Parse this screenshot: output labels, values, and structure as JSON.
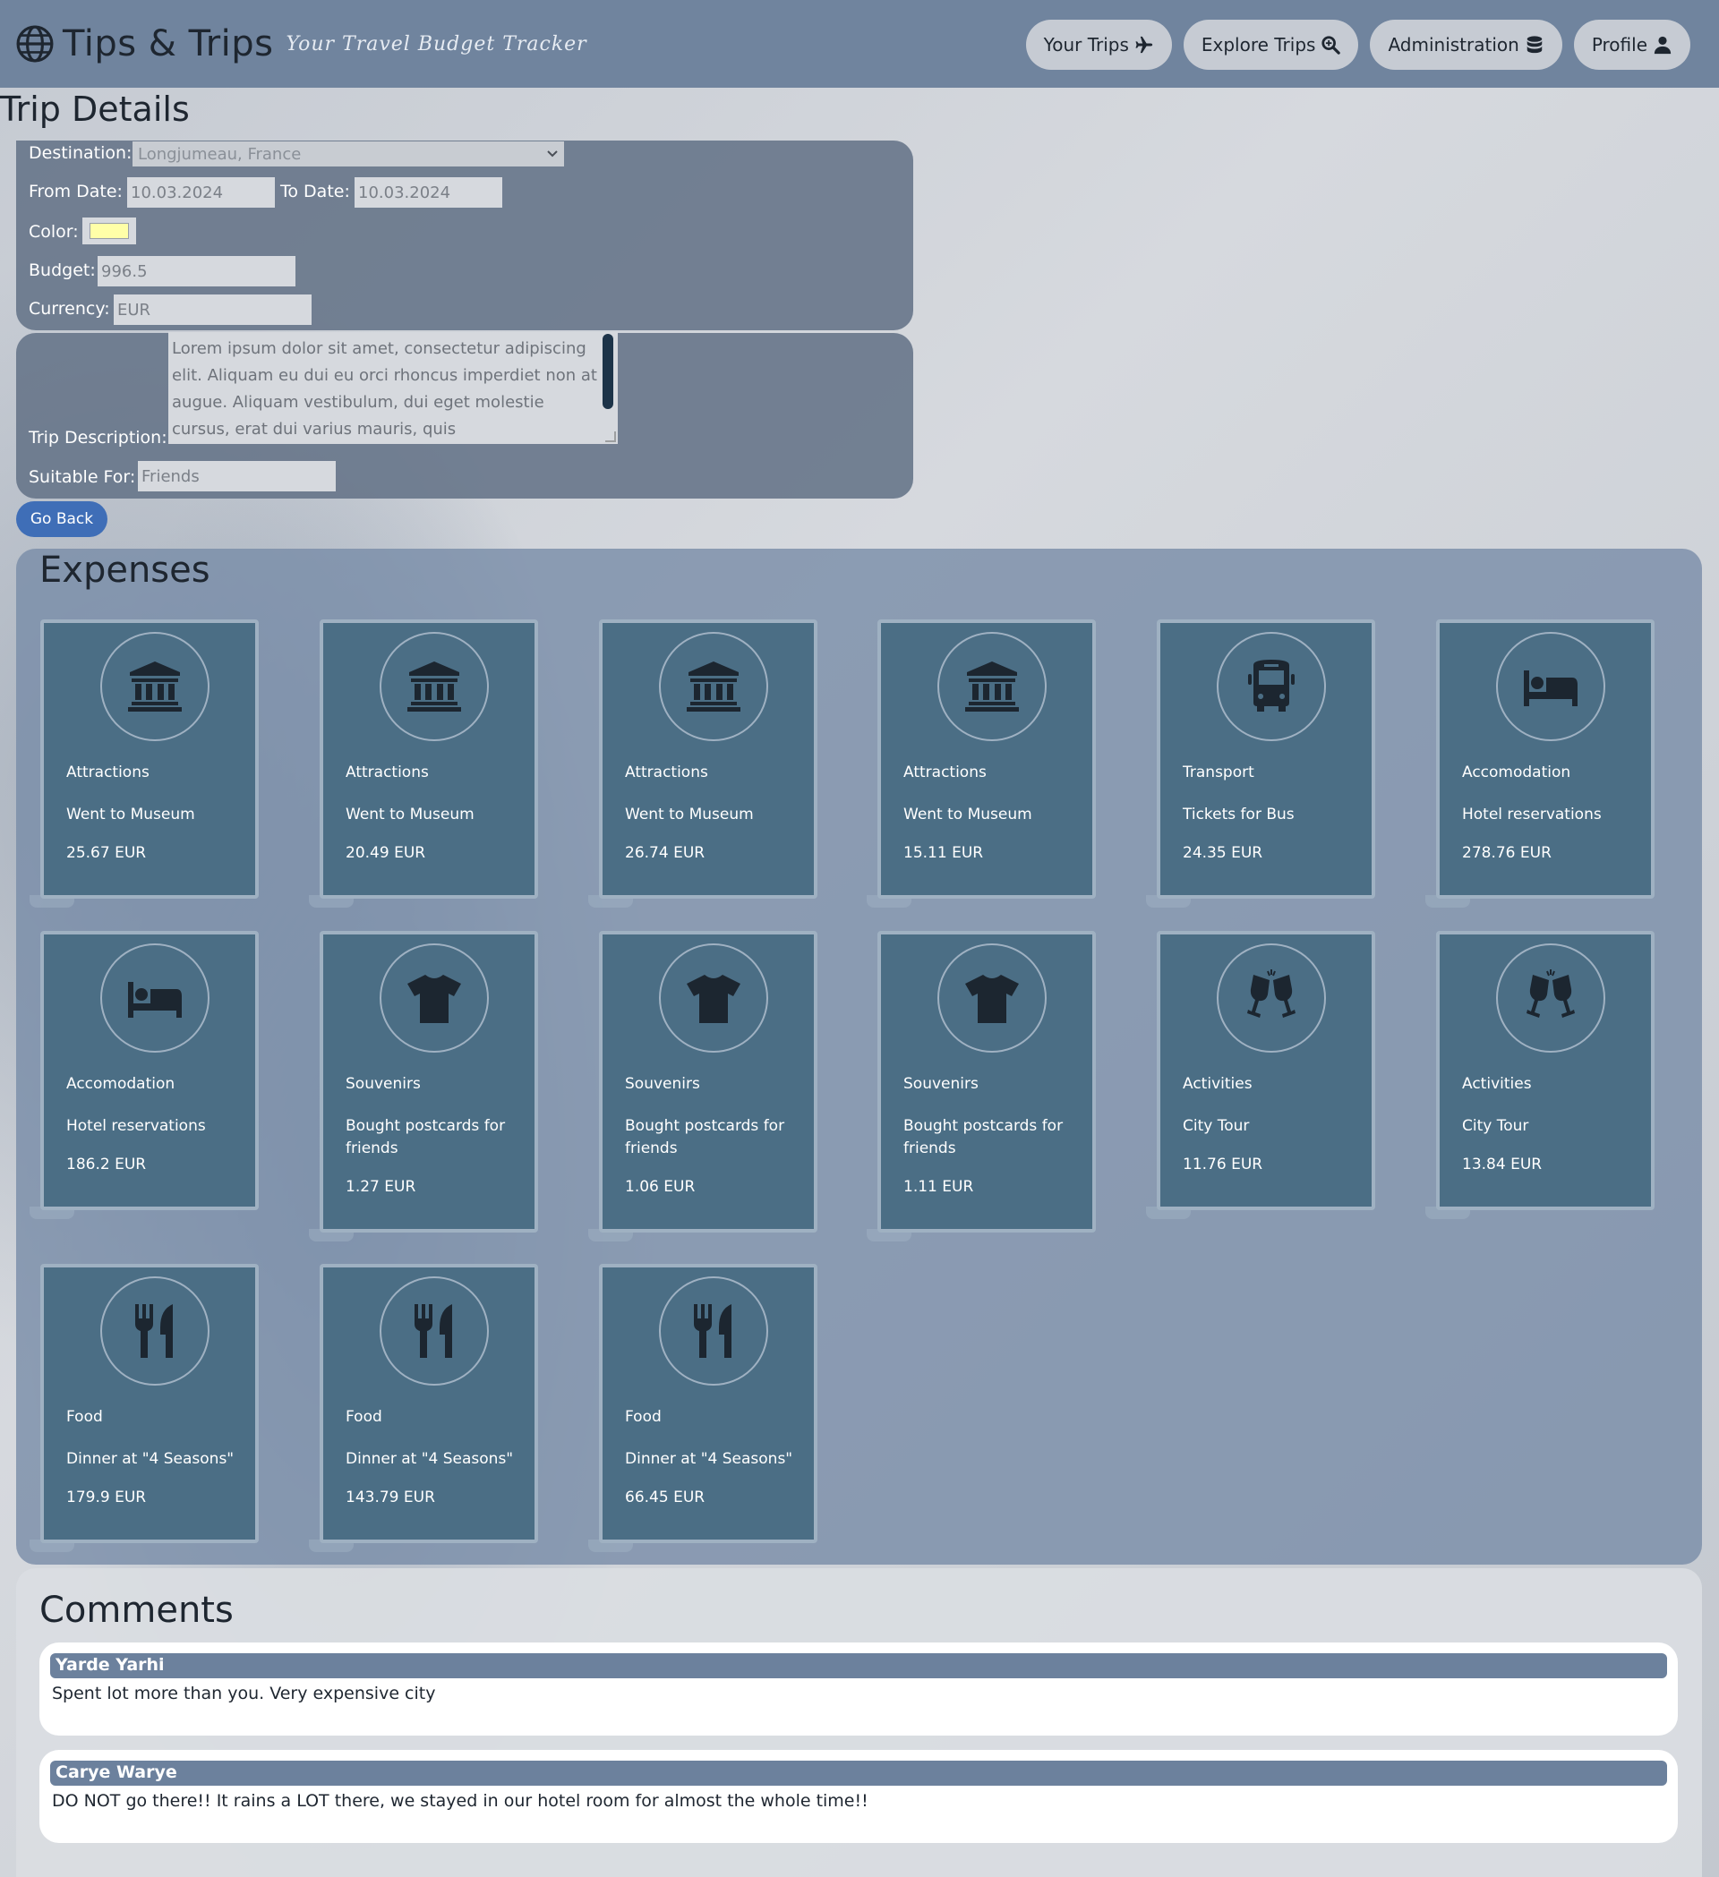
{
  "header": {
    "title": "Tips & Trips",
    "tagline": "Your Travel Budget Tracker",
    "nav": [
      {
        "label": "Your Trips",
        "icon": "plane-icon"
      },
      {
        "label": "Explore Trips",
        "icon": "search-icon"
      },
      {
        "label": "Administration",
        "icon": "database-icon"
      },
      {
        "label": "Profile",
        "icon": "user-icon"
      }
    ]
  },
  "trip": {
    "page_title": "Trip Details",
    "destination_label": "Destination:",
    "destination_value": "Longjumeau, France",
    "from_label": "From Date:",
    "from_value": "10.03.2024",
    "to_label": "To Date:",
    "to_value": "10.03.2024",
    "color_label": "Color:",
    "color_value": "#ffffa8",
    "budget_label": "Budget:",
    "budget_value": "996.5",
    "currency_label": "Currency:",
    "currency_value": "EUR",
    "description_label": "Trip Description:",
    "description_value": "Lorem ipsum dolor sit amet, consectetur adipiscing elit. Aliquam eu dui eu orci rhoncus imperdiet non at augue. Aliquam vestibulum, dui eget molestie cursus, erat dui varius mauris, quis",
    "suitable_label": "Suitable For:",
    "suitable_value": "Friends",
    "go_back_label": "Go Back"
  },
  "expenses": {
    "title": "Expenses",
    "items": [
      {
        "category": "Attractions",
        "description": "Went to Museum",
        "amount": "25.67 EUR",
        "icon": "museum-icon"
      },
      {
        "category": "Attractions",
        "description": "Went to Museum",
        "amount": "20.49 EUR",
        "icon": "museum-icon"
      },
      {
        "category": "Attractions",
        "description": "Went to Museum",
        "amount": "26.74 EUR",
        "icon": "museum-icon"
      },
      {
        "category": "Attractions",
        "description": "Went to Museum",
        "amount": "15.11 EUR",
        "icon": "museum-icon"
      },
      {
        "category": "Transport",
        "description": "Tickets for Bus",
        "amount": "24.35 EUR",
        "icon": "bus-icon"
      },
      {
        "category": "Accomodation",
        "description": "Hotel reservations",
        "amount": "278.76 EUR",
        "icon": "bed-icon"
      },
      {
        "category": "Accomodation",
        "description": "Hotel reservations",
        "amount": "186.2 EUR",
        "icon": "bed-icon"
      },
      {
        "category": "Souvenirs",
        "description": "Bought postcards for friends",
        "amount": "1.27 EUR",
        "icon": "tshirt-icon"
      },
      {
        "category": "Souvenirs",
        "description": "Bought postcards for friends",
        "amount": "1.06 EUR",
        "icon": "tshirt-icon"
      },
      {
        "category": "Souvenirs",
        "description": "Bought postcards for friends",
        "amount": "1.11 EUR",
        "icon": "tshirt-icon"
      },
      {
        "category": "Activities",
        "description": "City Tour",
        "amount": "11.76 EUR",
        "icon": "glasses-cheers-icon"
      },
      {
        "category": "Activities",
        "description": "City Tour",
        "amount": "13.84 EUR",
        "icon": "glasses-cheers-icon"
      },
      {
        "category": "Food",
        "description": "Dinner at \"4 Seasons\"",
        "amount": "179.9 EUR",
        "icon": "utensils-icon"
      },
      {
        "category": "Food",
        "description": "Dinner at \"4 Seasons\"",
        "amount": "143.79 EUR",
        "icon": "utensils-icon"
      },
      {
        "category": "Food",
        "description": "Dinner at \"4 Seasons\"",
        "amount": "66.45 EUR",
        "icon": "utensils-icon"
      }
    ]
  },
  "comments": {
    "title": "Comments",
    "items": [
      {
        "author": "Yarde Yarhi",
        "text": "Spent lot more than you. Very expensive city"
      },
      {
        "author": "Carye Warye",
        "text": "DO NOT go there!! It rains a LOT there, we stayed in our hotel room for almost the whole time!!"
      }
    ]
  }
}
